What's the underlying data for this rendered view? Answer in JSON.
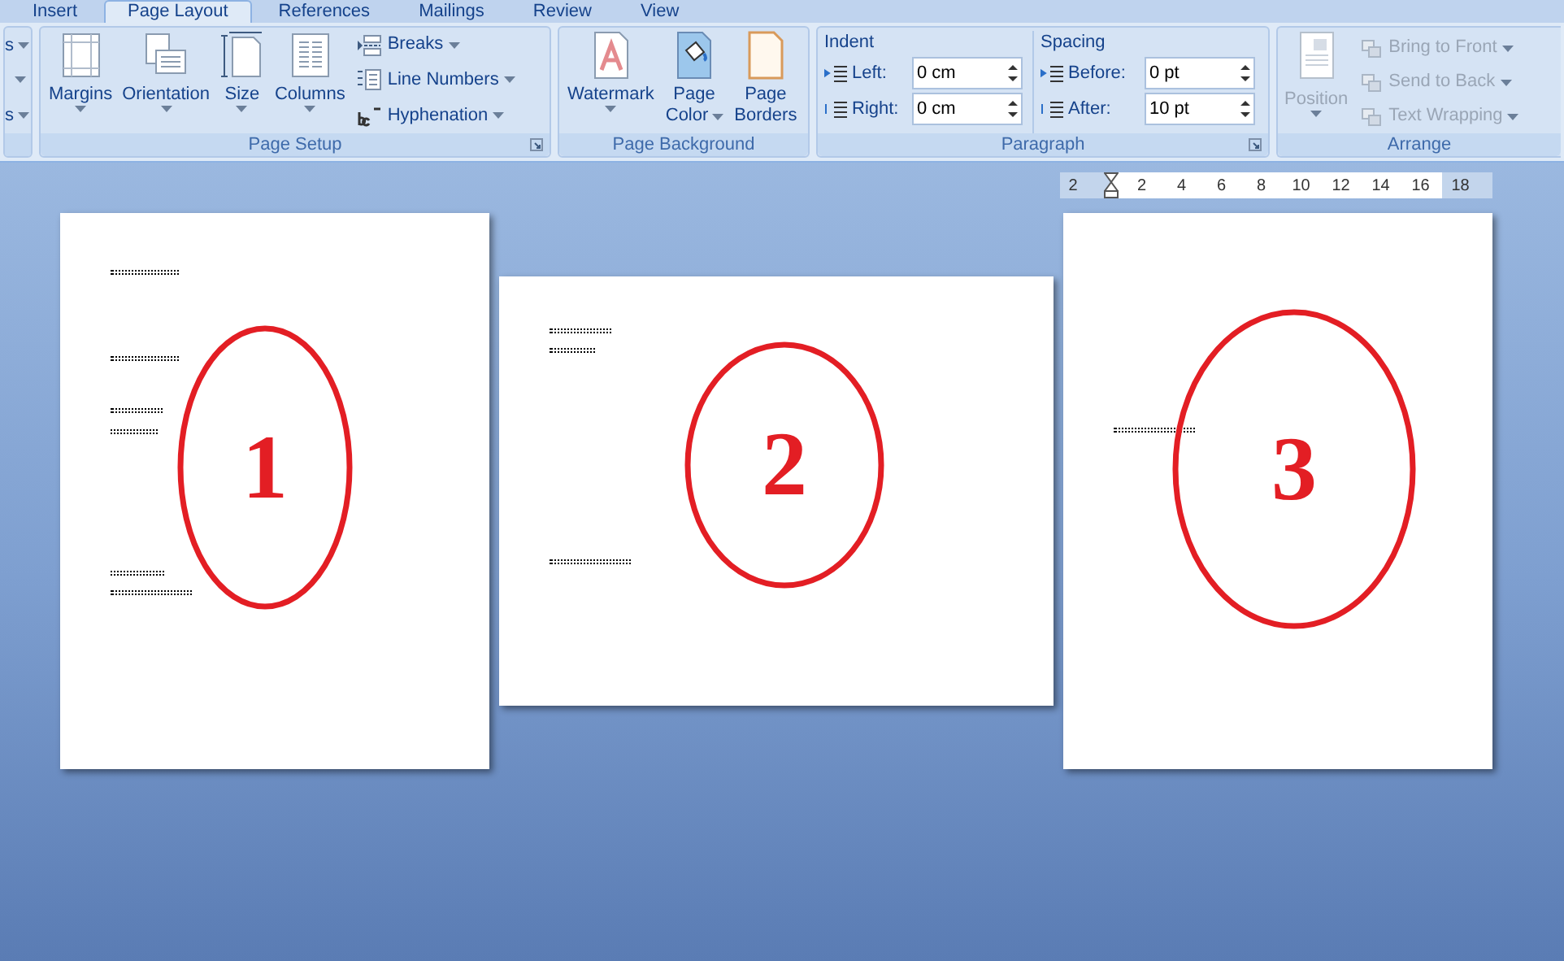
{
  "tabs": [
    {
      "label": "Insert",
      "selected": false
    },
    {
      "label": "Page Layout",
      "selected": true
    },
    {
      "label": "References",
      "selected": false
    },
    {
      "label": "Mailings",
      "selected": false
    },
    {
      "label": "Review",
      "selected": false
    },
    {
      "label": "View",
      "selected": false
    }
  ],
  "cut_group": {
    "items": [
      "s",
      "s"
    ]
  },
  "page_setup": {
    "title": "Page Setup",
    "large_buttons": [
      {
        "label": "Margins"
      },
      {
        "label": "Orientation"
      },
      {
        "label": "Size"
      },
      {
        "label": "Columns"
      }
    ],
    "small_buttons": [
      {
        "label": "Breaks"
      },
      {
        "label": "Line Numbers"
      },
      {
        "label": "Hyphenation"
      }
    ]
  },
  "page_background": {
    "title": "Page Background",
    "buttons": [
      {
        "label": "Watermark"
      },
      {
        "label": "Page",
        "label2": "Color"
      },
      {
        "label": "Page",
        "label2": "Borders"
      }
    ]
  },
  "paragraph": {
    "title": "Paragraph",
    "indent": {
      "heading": "Indent",
      "fields": [
        {
          "label": "Left:",
          "value": "0 cm"
        },
        {
          "label": "Right:",
          "value": "0 cm"
        }
      ]
    },
    "spacing": {
      "heading": "Spacing",
      "fields": [
        {
          "label": "Before:",
          "value": "0 pt"
        },
        {
          "label": "After:",
          "value": "10 pt"
        }
      ]
    }
  },
  "arrange": {
    "title": "Arrange",
    "position": {
      "label": "Position",
      "disabled": true
    },
    "items": [
      {
        "label": "Bring to Front",
        "disabled": true
      },
      {
        "label": "Send to Back",
        "disabled": true
      },
      {
        "label": "Text Wrapping",
        "disabled": true
      }
    ]
  },
  "ruler": {
    "numbers": [
      "2",
      "2",
      "4",
      "6",
      "8",
      "10",
      "12",
      "14",
      "16",
      "18"
    ]
  },
  "pages": [
    {
      "kind": "portrait",
      "number": "1"
    },
    {
      "kind": "landscape",
      "number": "2"
    },
    {
      "kind": "portrait",
      "number": "3"
    }
  ]
}
